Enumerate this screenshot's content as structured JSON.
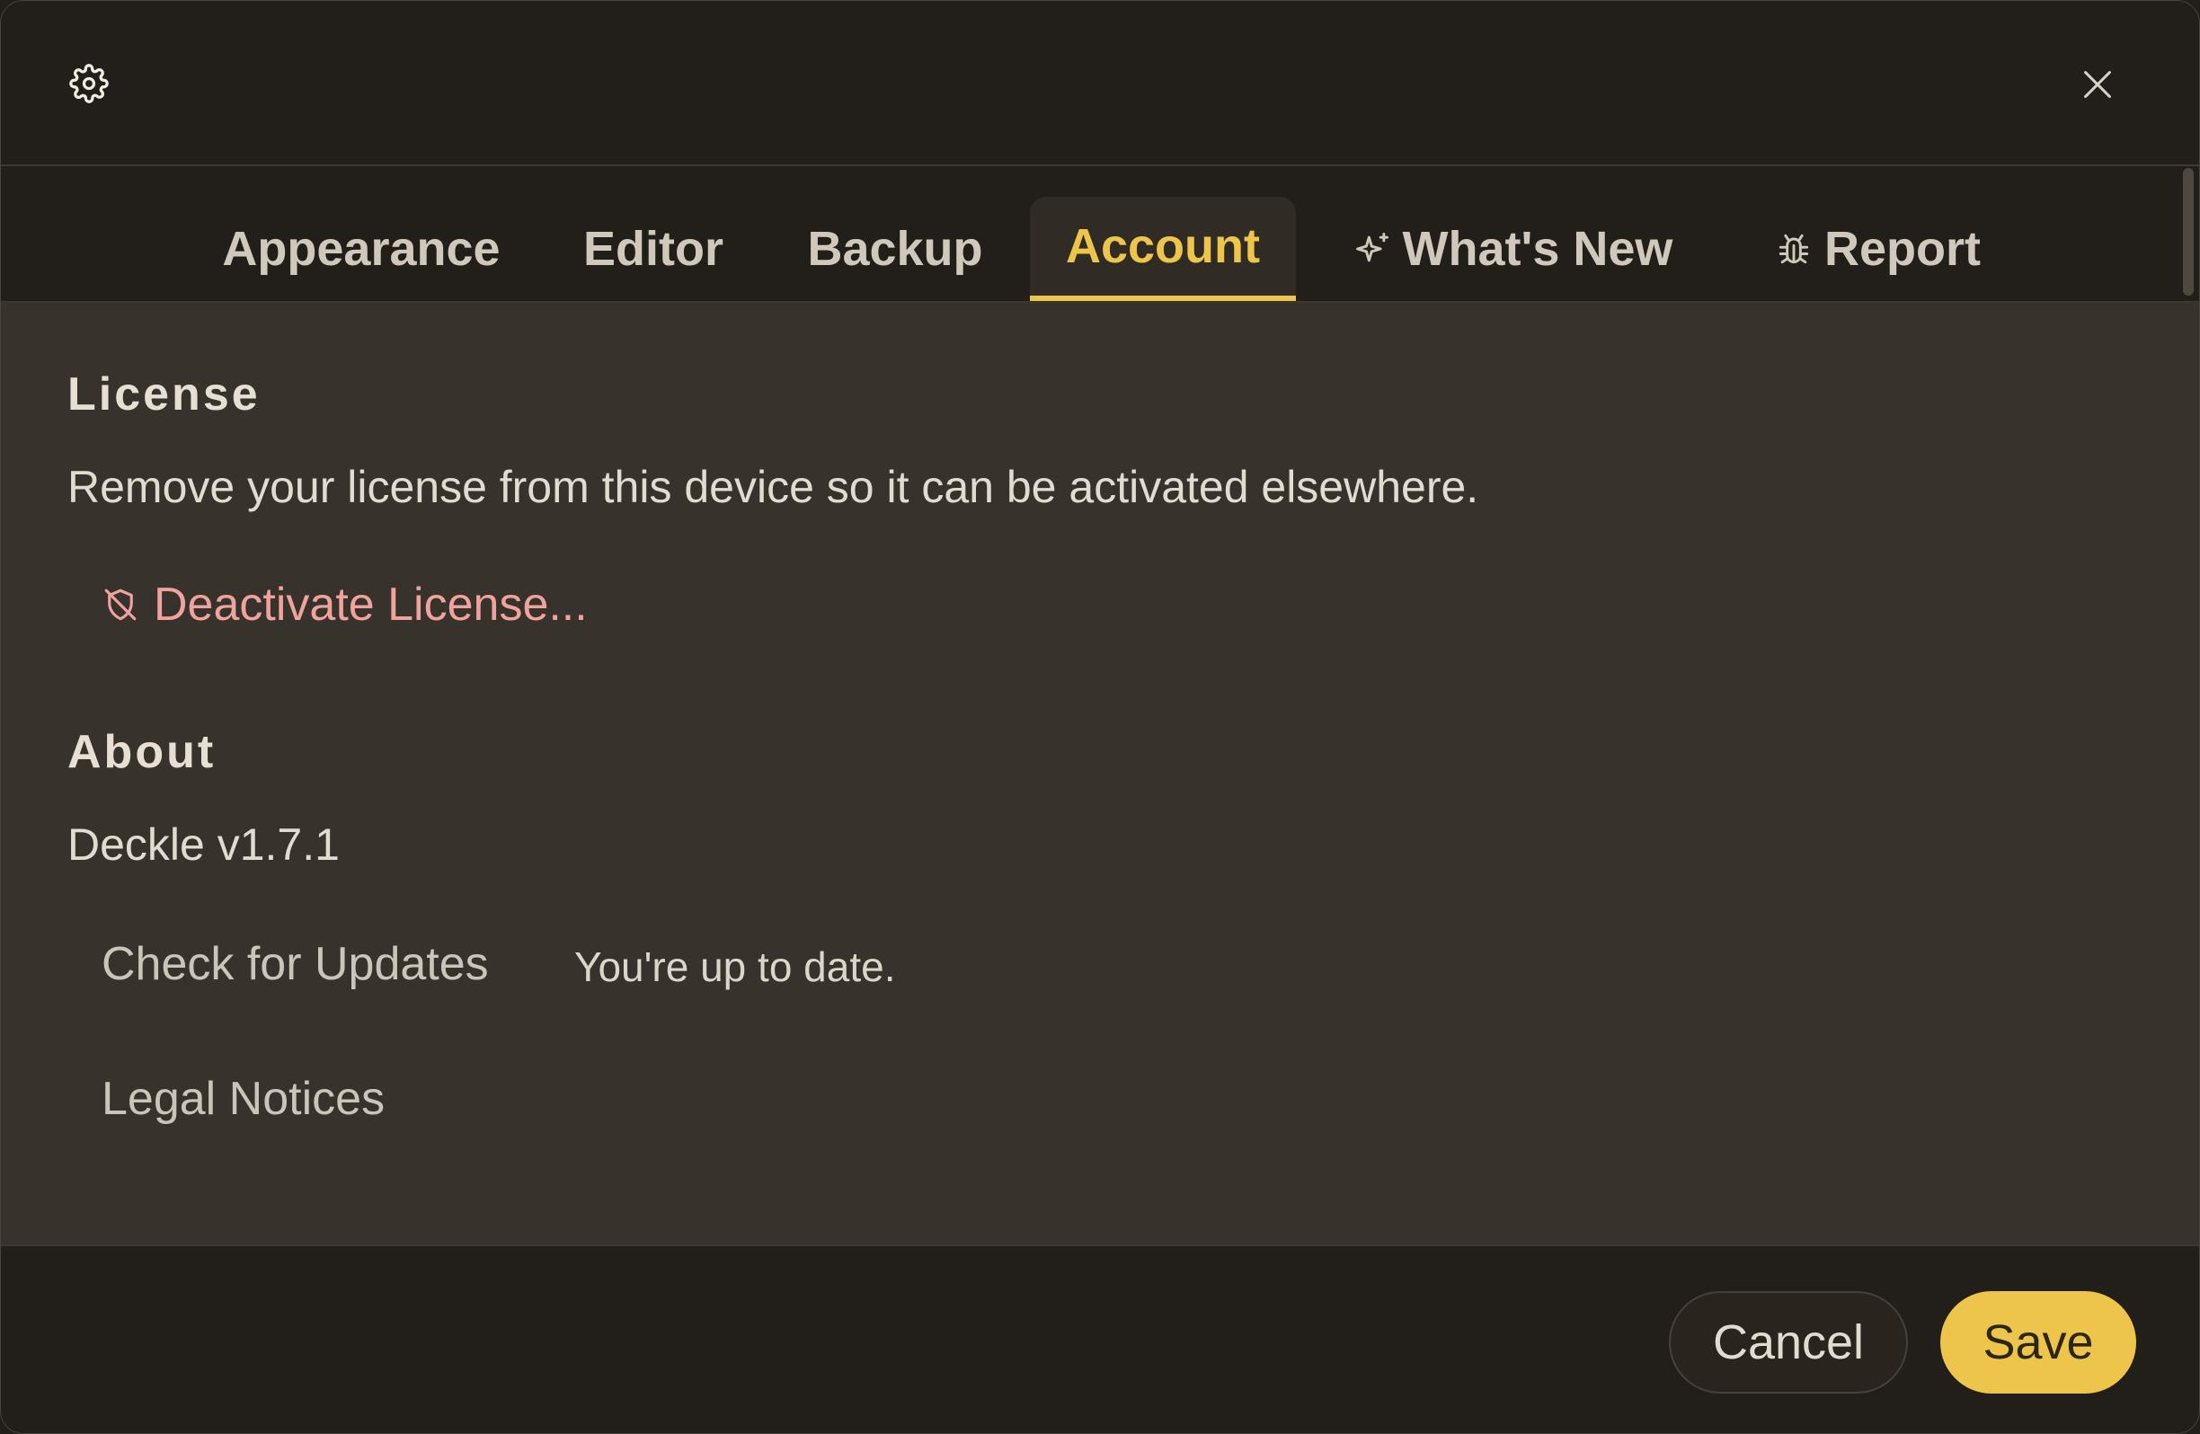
{
  "tabs": [
    {
      "label": "Appearance",
      "icon": null
    },
    {
      "label": "Editor",
      "icon": null
    },
    {
      "label": "Backup",
      "icon": null
    },
    {
      "label": "Account",
      "icon": null,
      "active": true
    },
    {
      "label": "What's New",
      "icon": "sparkles-icon"
    },
    {
      "label": "Report",
      "icon": "bug-icon"
    }
  ],
  "license": {
    "title": "License",
    "description": "Remove your license from this device so it can be activated elsewhere.",
    "deactivate_label": "Deactivate License...",
    "deactivate_icon": "shield-off-icon"
  },
  "about": {
    "title": "About",
    "version": "Deckle v1.7.1",
    "check_updates_label": "Check for Updates",
    "update_status": "You're up to date.",
    "legal_label": "Legal Notices"
  },
  "footer": {
    "cancel_label": "Cancel",
    "save_label": "Save"
  },
  "colors": {
    "accent": "#ecc54a",
    "danger": "#f0a29c",
    "background": "#221e19",
    "panel": "#37322c"
  },
  "icons": {
    "header": "gear-icon",
    "close": "close-icon"
  }
}
